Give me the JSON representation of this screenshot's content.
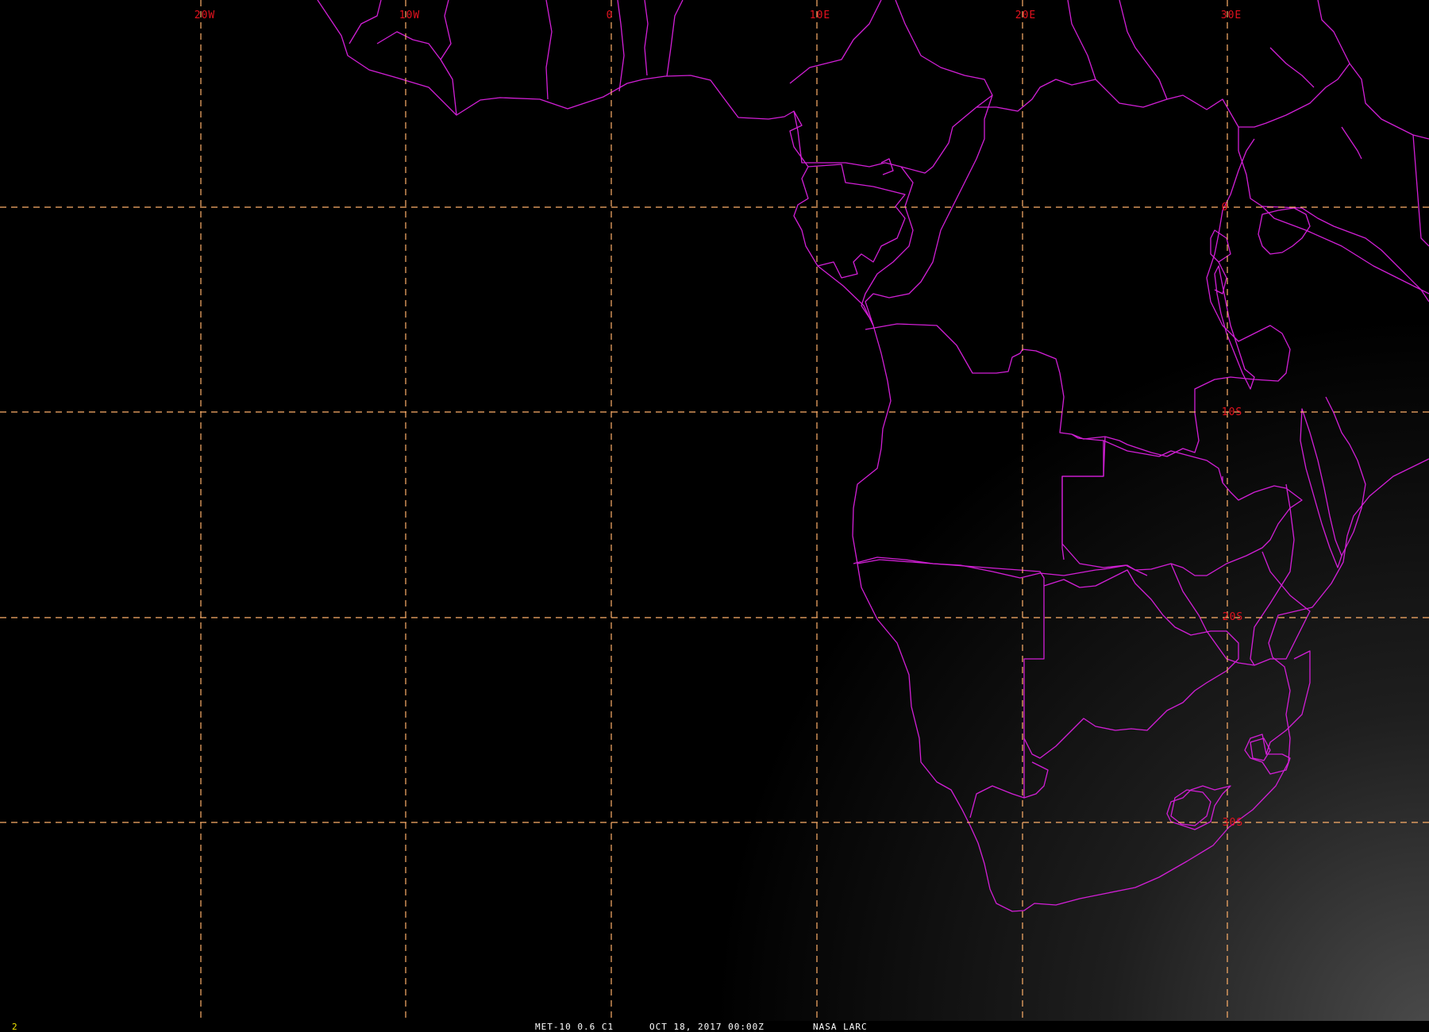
{
  "map": {
    "gridlines": {
      "longitudes": [
        "20W",
        "10W",
        "0",
        "10E",
        "20E",
        "30E"
      ],
      "latitudes": [
        "0",
        "10S",
        "20S",
        "30S"
      ]
    },
    "colors": {
      "background": "#000000",
      "grid": "#ffb06a",
      "labels": "#e3121e",
      "borders": "#d21fd6",
      "status_text": "#ffffff",
      "frame_number": "#f2e600"
    }
  },
  "status_bar": {
    "frame_number": "2",
    "satellite_channel": "MET-10 0.6 C1",
    "datetime": "OCT 18, 2017 00:00Z",
    "source": "NASA LARC"
  }
}
